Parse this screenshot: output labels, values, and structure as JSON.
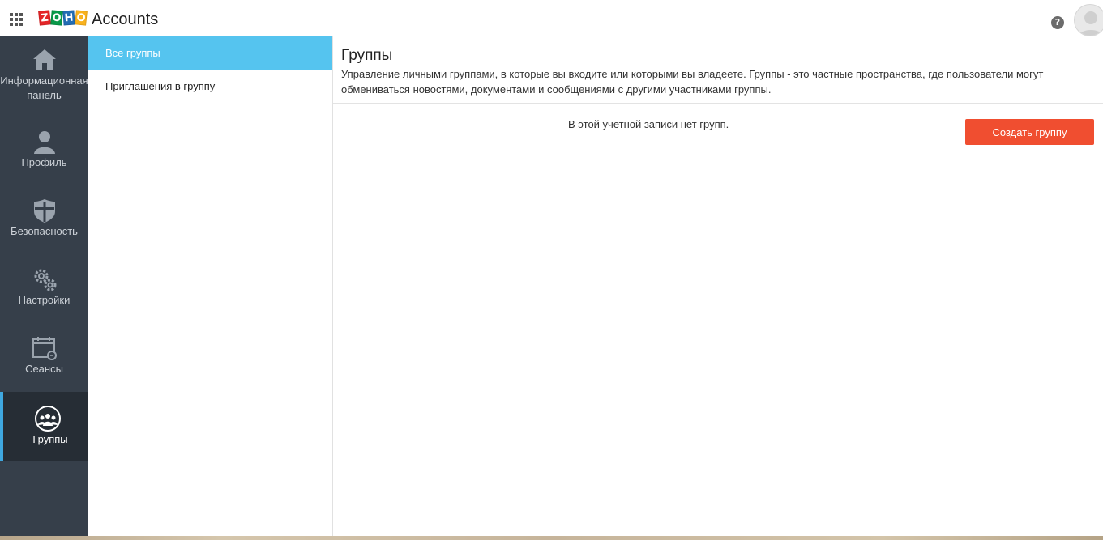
{
  "header": {
    "logo_letters": [
      "Z",
      "O",
      "H",
      "O"
    ],
    "logo_colors": [
      "#e42527",
      "#089949",
      "#226db4",
      "#f9b21d"
    ],
    "app_title": "Accounts",
    "help_icon": "?"
  },
  "sidebar": {
    "items": [
      {
        "label": "Информационная панель",
        "icon": "home-icon"
      },
      {
        "label": "Профиль",
        "icon": "user-icon"
      },
      {
        "label": "Безопасность",
        "icon": "shield-icon"
      },
      {
        "label": "Настройки",
        "icon": "gear-icon"
      },
      {
        "label": "Сеансы",
        "icon": "calendar-icon"
      },
      {
        "label": "Группы",
        "icon": "groups-icon",
        "active": true
      }
    ]
  },
  "subnav": {
    "items": [
      {
        "label": "Все группы",
        "active": true
      },
      {
        "label": "Приглашения в группу"
      }
    ]
  },
  "main": {
    "title": "Группы",
    "description": "Управление личными группами, в которые вы входите или которыми вы владеете. Группы - это частные пространства, где пользователи могут обмениваться новостями, документами и сообщениями с другими участниками группы.",
    "empty_message": "В этой учетной записи нет групп.",
    "create_button": "Создать группу"
  },
  "colors": {
    "sidebar_bg": "#363f4a",
    "active_subnav": "#55c4ef",
    "accent_button": "#f04e30",
    "active_indicator": "#3fa8e0"
  }
}
